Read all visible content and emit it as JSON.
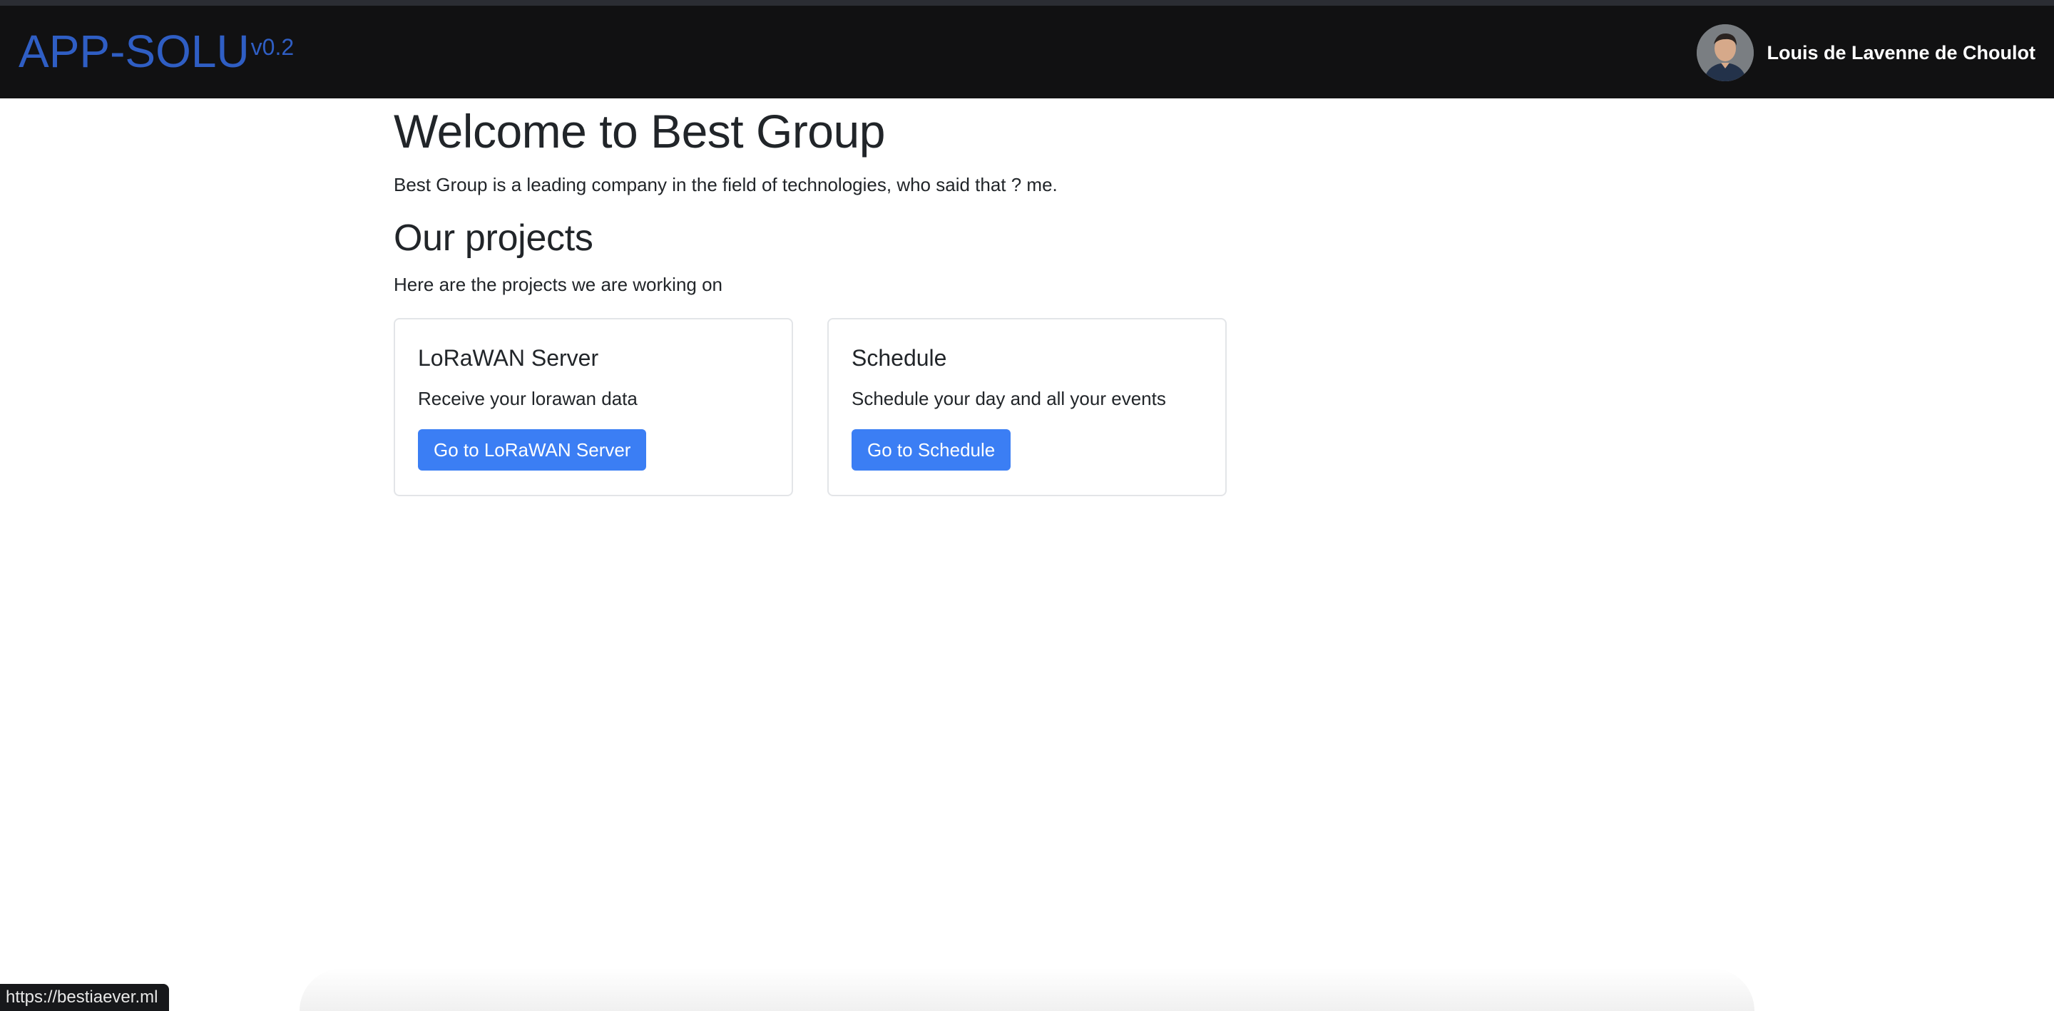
{
  "navbar": {
    "brand": "APP-SOLU",
    "version": "v0.2",
    "user_name": "Louis de Lavenne de Choulot",
    "avatar_icon": "user-avatar-photo"
  },
  "main": {
    "title": "Welcome to Best Group",
    "intro": "Best Group is a leading company in the field of technologies, who said that ? me.",
    "projects_title": "Our projects",
    "projects_subtitle": "Here are the projects we are working on",
    "cards": [
      {
        "title": "LoRaWAN Server",
        "text": "Receive your lorawan data",
        "button": "Go to LoRaWAN Server"
      },
      {
        "title": "Schedule",
        "text": "Schedule your day and all your events",
        "button": "Go to Schedule"
      }
    ]
  },
  "status_bar": {
    "url": "https://bestiaever.ml"
  },
  "colors": {
    "navbar_bg": "#111112",
    "brand": "#2f5ec4",
    "button": "#3b7ef4"
  }
}
